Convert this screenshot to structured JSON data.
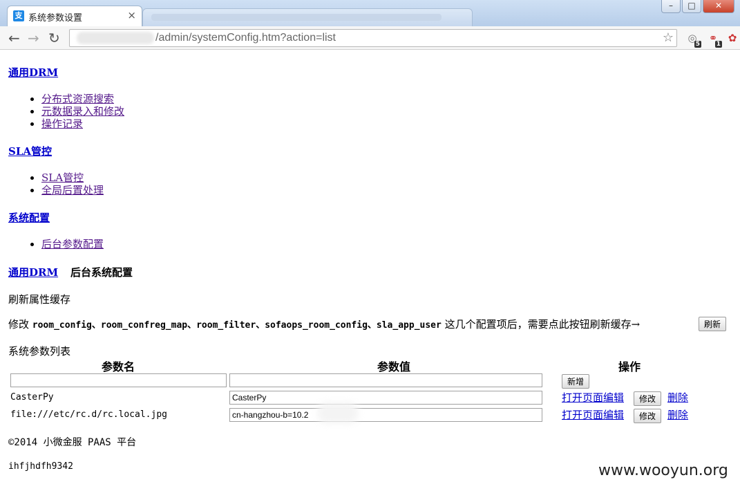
{
  "browser": {
    "tab_title": "系统参数设置",
    "tab_favicon": "支",
    "tab_close": "×",
    "window_buttons": [
      "–",
      "□",
      "✕"
    ],
    "nav": {
      "back": "←",
      "forward": "→",
      "reload": "↻"
    },
    "url": "/admin/systemConfig.htm?action=list",
    "star": "☆",
    "extensions": [
      {
        "icon": "magnifier-icon",
        "glyph": "◎",
        "badge": "5"
      },
      {
        "icon": "chain-icon",
        "glyph": "⚭",
        "badge": "1"
      },
      {
        "icon": "paint-icon",
        "glyph": "✿"
      }
    ]
  },
  "menu": {
    "sections": [
      {
        "title": "通用DRM",
        "items": [
          "分布式资源搜索",
          "元数据录入和修改",
          "操作记录"
        ]
      },
      {
        "title": "SLA管控",
        "items": [
          "SLA管控",
          "全局后置处理"
        ]
      },
      {
        "title": "系统配置",
        "items": [
          "后台参数配置"
        ]
      }
    ]
  },
  "breadcrumb": {
    "link": "通用DRM",
    "current": "后台系统配置"
  },
  "refresh": {
    "heading": "刷新属性缓存",
    "prefix": "修改 ",
    "configs": "room_config、room_confreg_map、room_filter、sofaops_room_config、sla_app_user",
    "suffix": " 这几个配置项后，需要点此按钮刷新缓存→",
    "button": "刷新"
  },
  "params": {
    "heading": "系统参数列表",
    "columns": [
      "参数名",
      "参数值",
      "操作"
    ],
    "new_button": "新增",
    "rows": [
      {
        "name": "CasterPy",
        "value": "CasterPy",
        "edit_link": "打开页面编辑",
        "modify": "修改",
        "delete": "删除"
      },
      {
        "name": "file:///etc/rc.d/rc.local.jpg",
        "value": "cn-hangzhou-b=10.2",
        "edit_link": "打开页面编辑",
        "modify": "修改",
        "delete": "删除"
      }
    ]
  },
  "footer": {
    "copyright": "©2014 小微金服 PAAS 平台",
    "code": "ihfjhdfh9342"
  },
  "watermark": "www.wooyun.org"
}
